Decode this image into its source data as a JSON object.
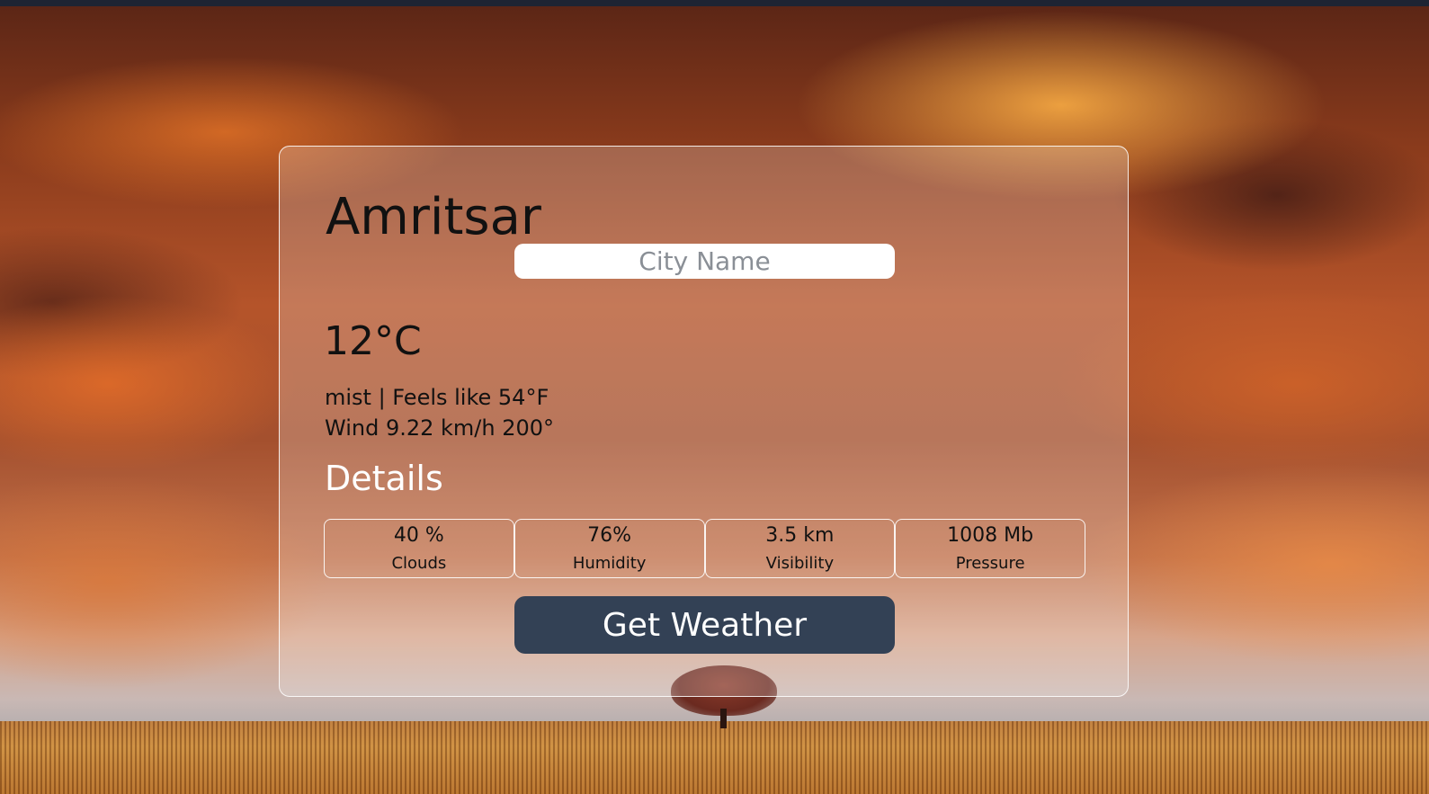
{
  "weather": {
    "city": "Amritsar",
    "temperature": "12°C",
    "condition_line": "mist | Feels like 54°F",
    "wind_line": "Wind 9.22 km/h 200°"
  },
  "search": {
    "placeholder": "City Name",
    "value": ""
  },
  "details": {
    "heading": "Details",
    "items": [
      {
        "value": "40 %",
        "label": "Clouds"
      },
      {
        "value": "76%",
        "label": "Humidity"
      },
      {
        "value": "3.5 km",
        "label": "Visibility"
      },
      {
        "value": "1008 Mb",
        "label": "Pressure"
      }
    ]
  },
  "actions": {
    "get_weather_label": "Get Weather"
  },
  "colors": {
    "button_bg": "#334155",
    "input_bg": "#ffffff",
    "card_border": "#ffffff"
  }
}
